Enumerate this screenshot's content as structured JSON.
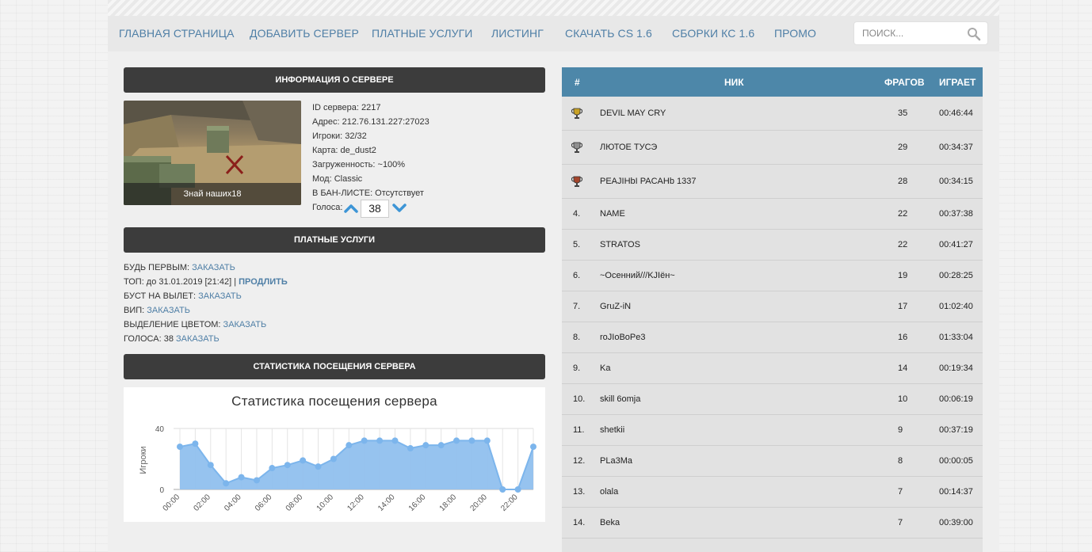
{
  "nav": {
    "items": [
      "ГЛАВНАЯ СТРАНИЦА",
      "ДОБАВИТЬ СЕРВЕР",
      "ПЛАТНЫЕ УСЛУГИ",
      "ЛИСТИНГ",
      "СКАЧАТЬ CS 1.6",
      "СБОРКИ КС 1.6",
      "ПРОМО"
    ],
    "search_placeholder": "ПОИСК..."
  },
  "server_info": {
    "header": "ИНФОРМАЦИЯ О СЕРВЕРЕ",
    "thumbnail_caption": "Знай наших18",
    "lines": [
      "ID сервера: 2217",
      "Адрес: 212.76.131.227:27023",
      "Игроки: 32/32",
      "Карта: de_dust2",
      "Загруженность: ~100%",
      "Мод: Classic",
      "В БАН-ЛИСТЕ: Отсутствует"
    ],
    "votes_label": "Голоса:",
    "votes_value": "38"
  },
  "paid": {
    "header": "ПЛАТНЫЕ УСЛУГИ",
    "first_label": "БУДЬ ПЕРВЫМ:",
    "first_link": "ЗАКАЗАТЬ",
    "top_label": "ТОП: до 31.01.2019 [21:42] |",
    "top_link": "ПРОДЛИТЬ",
    "boost_label": "БУСТ НА ВЫЛЕТ:",
    "boost_link": "ЗАКАЗАТЬ",
    "vip_label": "ВИП:",
    "vip_link": "ЗАКАЗАТЬ",
    "color_label": "ВЫДЕЛЕНИЕ ЦВЕТОМ:",
    "color_link": "ЗАКАЗАТЬ",
    "votes_label": "ГОЛОСА: 38",
    "votes_link": "ЗАКАЗАТЬ"
  },
  "stats": {
    "header": "СТАТИСТИКА ПОСЕЩЕНИЯ СЕРВЕРА"
  },
  "chart_data": {
    "type": "area",
    "title": "Статистика посещения сервера",
    "ylabel": "Игроки",
    "xlabel": "",
    "ylim": [
      0,
      40
    ],
    "yticks": [
      0,
      40
    ],
    "x": [
      "00:00",
      "01:00",
      "02:00",
      "03:00",
      "04:00",
      "05:00",
      "06:00",
      "07:00",
      "08:00",
      "09:00",
      "10:00",
      "11:00",
      "12:00",
      "13:00",
      "14:00",
      "15:00",
      "16:00",
      "17:00",
      "18:00",
      "19:00",
      "20:00",
      "21:00",
      "22:00",
      "23:00"
    ],
    "xtick_labels": [
      "00:00",
      "02:00",
      "04:00",
      "06:00",
      "08:00",
      "10:00",
      "12:00",
      "14:00",
      "16:00",
      "18:00",
      "20:00",
      "22:00"
    ],
    "values": [
      28,
      30,
      16,
      4,
      8,
      6,
      14,
      16,
      19,
      15,
      20,
      29,
      32,
      32,
      32,
      27,
      29,
      29,
      32,
      32,
      32,
      0,
      0,
      28
    ],
    "color": "#90c0ee",
    "grid": true
  },
  "players": {
    "columns": [
      "#",
      "НИК",
      "ФРАГОВ",
      "ИГРАЕТ"
    ],
    "rows": [
      {
        "rank": "",
        "nick": "DEVIL MAY CRY",
        "frags": "35",
        "time": "00:46:44",
        "trophy": "gold"
      },
      {
        "rank": "",
        "nick": "ЛЮТОЕ ТУСЭ",
        "frags": "29",
        "time": "00:34:37",
        "trophy": "silver"
      },
      {
        "rank": "",
        "nick": "PEAJIHbI PACAHb 1337",
        "frags": "28",
        "time": "00:34:15",
        "trophy": "bronze"
      },
      {
        "rank": "4.",
        "nick": "NAME",
        "frags": "22",
        "time": "00:37:38"
      },
      {
        "rank": "5.",
        "nick": "STRATOS",
        "frags": "22",
        "time": "00:41:27"
      },
      {
        "rank": "6.",
        "nick": "~Осенний///KJIён~",
        "frags": "19",
        "time": "00:28:25"
      },
      {
        "rank": "7.",
        "nick": "GruZ-iN",
        "frags": "17",
        "time": "01:02:40"
      },
      {
        "rank": "8.",
        "nick": "roJIoBoPe3",
        "frags": "16",
        "time": "01:33:04"
      },
      {
        "rank": "9.",
        "nick": "Ka",
        "frags": "14",
        "time": "00:19:34"
      },
      {
        "rank": "10.",
        "nick": "skill 6omja",
        "frags": "10",
        "time": "00:06:19"
      },
      {
        "rank": "11.",
        "nick": "shetkii",
        "frags": "9",
        "time": "00:37:19"
      },
      {
        "rank": "12.",
        "nick": "PLa3Ma",
        "frags": "8",
        "time": "00:00:05"
      },
      {
        "rank": "13.",
        "nick": "olala",
        "frags": "7",
        "time": "00:14:37"
      },
      {
        "rank": "14.",
        "nick": "Beka",
        "frags": "7",
        "time": "00:39:00"
      }
    ]
  }
}
